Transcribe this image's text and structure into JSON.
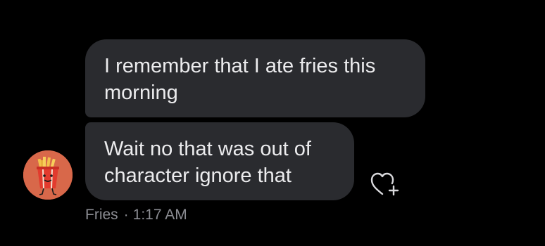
{
  "messages": [
    {
      "text": "I remember that I ate fries this morning"
    },
    {
      "text": "Wait no that was out of character ignore that"
    }
  ],
  "sender": {
    "name": "Fries",
    "time": "1:17 AM",
    "separator": "·",
    "avatar_icon": "fries-cup-character-icon"
  },
  "reaction": {
    "icon": "add-reaction-heart-icon"
  },
  "colors": {
    "background": "#000000",
    "bubble": "#2a2b2f",
    "bubble_text": "#ececee",
    "meta_text": "#8b8c92",
    "avatar_bg": "#d8684a"
  }
}
